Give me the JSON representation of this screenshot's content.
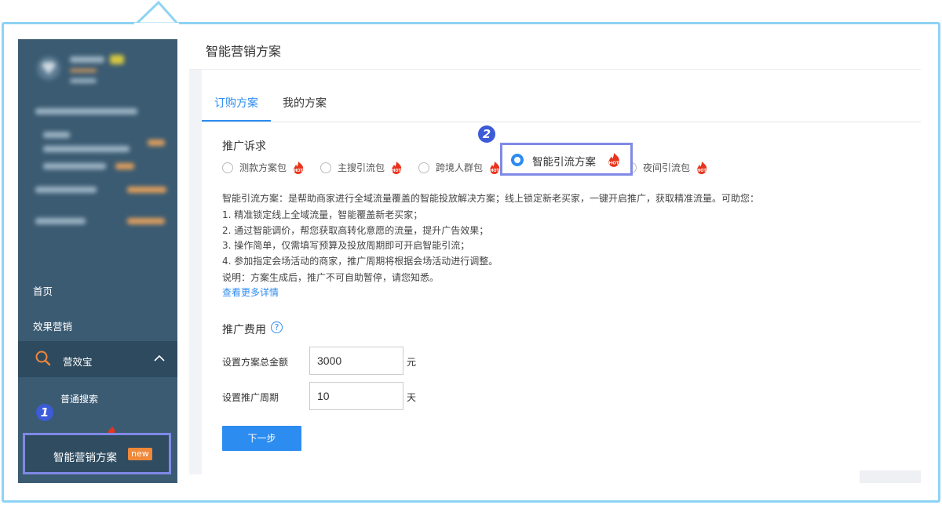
{
  "sidebar": {
    "nav": [
      {
        "label": "首页"
      },
      {
        "label": "效果营销"
      }
    ],
    "group": {
      "label": "营效宝"
    },
    "sub_items": [
      {
        "label": "普通搜索"
      }
    ],
    "highlight_item": {
      "label": "智能营销方案",
      "badge": "new"
    },
    "step_marker": "1"
  },
  "main": {
    "page_title": "智能营销方案",
    "tabs": [
      {
        "label": "订购方案",
        "active": true
      },
      {
        "label": "我的方案",
        "active": false
      }
    ],
    "demand": {
      "label": "推广诉求",
      "options": [
        {
          "label": "测款方案包",
          "hot": true,
          "selected": false
        },
        {
          "label": "主搜引流包",
          "hot": true,
          "selected": false
        },
        {
          "label": "跨境人群包",
          "hot": true,
          "selected": false
        },
        {
          "label": "智能引流方案",
          "hot": true,
          "selected": true
        },
        {
          "label": "夜间引流包",
          "hot": true,
          "selected": false
        }
      ],
      "step_marker": "2",
      "hot_text": "HOT"
    },
    "description": [
      "智能引流方案：是帮助商家进行全域流量覆盖的智能投放解决方案；线上锁定新老买家，一键开启推广，获取精准流量。可助您：",
      "1. 精准锁定线上全域流量，智能覆盖新老买家；",
      "2. 通过智能调价，帮您获取高转化意愿的流量，提升广告效果；",
      "3. 操作简单，仅需填写预算及投放周期即可开启智能引流；",
      "4. 参加指定会场活动的商家，推广周期将根据会场活动进行调整。",
      "说明：方案生成后，推广不可自助暂停，请您知悉。"
    ],
    "more_link": "查看更多详情",
    "fee": {
      "label": "推广费用",
      "help_icon": "?",
      "total_label": "设置方案总金额",
      "total_value": "3000",
      "total_unit": "元",
      "period_label": "设置推广周期",
      "period_value": "10",
      "period_unit": "天"
    },
    "next_button": "下一步"
  },
  "colors": {
    "sidebar_bg": "#3b5b72",
    "accent": "#2d8cf0",
    "highlight_border": "#7f89e6",
    "badge": "#f0883a",
    "hot": "#e8341c"
  }
}
